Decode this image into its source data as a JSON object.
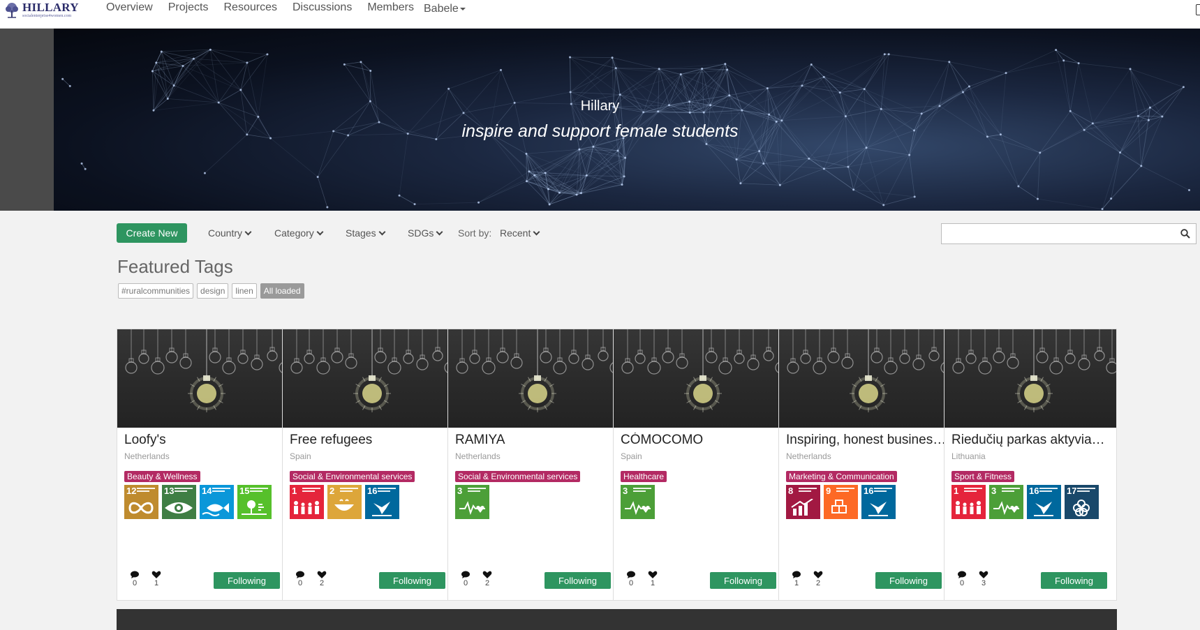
{
  "nav": {
    "logo_title": "HILLARY",
    "logo_sub": "socialenterprise4women.com",
    "links": [
      "Overview",
      "Projects",
      "Resources",
      "Discussions",
      "Members"
    ],
    "user": "Babele"
  },
  "banner": {
    "title": "Hillary",
    "subtitle": "inspire and support female students"
  },
  "toolbar": {
    "create_label": "Create New",
    "filters": [
      "Country",
      "Category",
      "Stages",
      "SDGs"
    ],
    "sort_label": "Sort by:",
    "sort_value": "Recent",
    "search_value": ""
  },
  "featured": {
    "title": "Featured Tags",
    "tags": [
      "#ruralcommunities",
      "design",
      "linen"
    ],
    "loaded_label": "All loaded"
  },
  "cards": [
    {
      "title": "Loofy's",
      "country": "Netherlands",
      "category": "Beauty & Wellness",
      "sdgs": [
        12,
        13,
        14,
        15
      ],
      "comments": "0",
      "likes": "1",
      "follow_label": "Following"
    },
    {
      "title": "Free refugees",
      "country": "Spain",
      "category": "Social & Environmental services",
      "sdgs": [
        1,
        2,
        16
      ],
      "comments": "0",
      "likes": "2",
      "follow_label": "Following"
    },
    {
      "title": "RAMIYA",
      "country": "Netherlands",
      "category": "Social & Environmental services",
      "sdgs": [
        3
      ],
      "comments": "0",
      "likes": "2",
      "follow_label": "Following"
    },
    {
      "title": "CÓMOCOMO",
      "country": "Spain",
      "category": "Healthcare",
      "sdgs": [
        3
      ],
      "comments": "0",
      "likes": "1",
      "follow_label": "Following"
    },
    {
      "title": "Inspiring, honest business...",
      "country": "Netherlands",
      "category": "Marketing & Communication",
      "sdgs": [
        8,
        9,
        16
      ],
      "comments": "1",
      "likes": "2",
      "follow_label": "Following"
    },
    {
      "title": "Riedučių parkas aktyviam ...",
      "country": "Lithuania",
      "category": "Sport & Fitness",
      "sdgs": [
        1,
        3,
        16,
        17
      ],
      "comments": "0",
      "likes": "3",
      "follow_label": "Following"
    }
  ],
  "sdg_colors": {
    "1": "#e5243b",
    "2": "#dda63a",
    "3": "#4c9f38",
    "8": "#a21942",
    "9": "#fd6925",
    "12": "#bf8b2e",
    "13": "#3f7e44",
    "14": "#0a97d9",
    "15": "#56c02b",
    "16": "#00689d",
    "17": "#19486a"
  }
}
